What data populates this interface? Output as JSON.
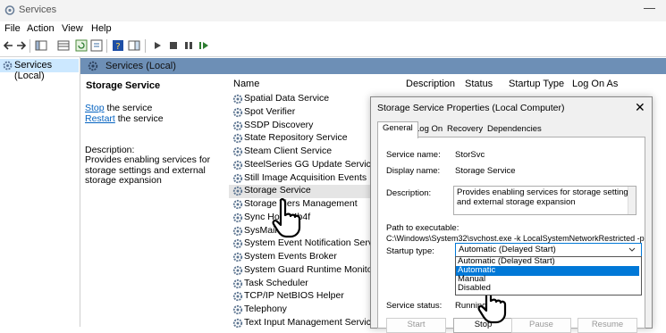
{
  "window": {
    "title": "Services",
    "minimize_glyph": "—"
  },
  "menu": {
    "items": [
      "File",
      "Action",
      "View",
      "Help"
    ]
  },
  "tree": {
    "root_label": "Services (Local)"
  },
  "panel_header": {
    "title": "Services (Local)"
  },
  "description_panel": {
    "service_name": "Storage Service",
    "stop_link": "Stop",
    "stop_suffix": " the service",
    "restart_link": "Restart",
    "restart_suffix": " the service",
    "description_label": "Description:",
    "description_text": "Provides enabling services for storage settings and external storage expansion"
  },
  "list": {
    "columns": [
      "Name",
      "Description",
      "Status",
      "Startup Type",
      "Log On As"
    ],
    "rows": [
      "Spatial Data Service",
      "Spot Verifier",
      "SSDP Discovery",
      "State Repository Service",
      "Steam Client Service",
      "SteelSeries GG Update Service Prox",
      "Still Image Acquisition Events",
      "Storage Service",
      "Storage Tiers Management",
      "Sync Host_4b4f",
      "SysMain",
      "System Event Notification Service",
      "System Events Broker",
      "System Guard Runtime Monitor Br",
      "Task Scheduler",
      "TCP/IP NetBIOS Helper",
      "Telephony",
      "Text Input Management Service"
    ],
    "selected_row": "Storage Service"
  },
  "dialog": {
    "title": "Storage Service Properties (Local Computer)",
    "close_glyph": "✕",
    "tabs": [
      "General",
      "Log On",
      "Recovery",
      "Dependencies"
    ],
    "active_tab": "General",
    "service_name_label": "Service name:",
    "service_name_value": "StorSvc",
    "display_name_label": "Display name:",
    "display_name_value": "Storage Service",
    "description_label": "Description:",
    "description_value": "Provides enabling services for storage settings and external storage expansion",
    "path_label": "Path to executable:",
    "path_value": "C:\\Windows\\System32\\svchost.exe -k LocalSystemNetworkRestricted -p",
    "startup_label": "Startup type:",
    "startup_value": "Automatic (Delayed Start)",
    "startup_options": [
      "Automatic (Delayed Start)",
      "Automatic",
      "Manual",
      "Disabled"
    ],
    "startup_highlighted": "Automatic",
    "status_label": "Service status:",
    "status_value": "Running",
    "buttons": {
      "start": "Start",
      "stop": "Stop",
      "pause": "Pause",
      "resume": "Resume"
    }
  },
  "colors": {
    "selection": "#cce8ff",
    "header_bar": "#6d8fb6",
    "dropdown_highlight": "#0078d7",
    "link": "#0563c1"
  }
}
